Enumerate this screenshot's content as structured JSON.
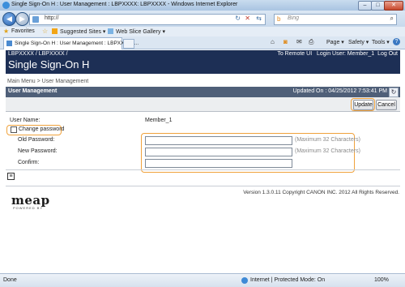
{
  "window": {
    "title": "Single Sign-On H : User Management : LBPXXXX: LBPXXXX - Windows Internet Explorer",
    "minimize": "–",
    "maximize": "□",
    "close": "✕"
  },
  "address": {
    "url": "http://",
    "search_placeholder": "Bing"
  },
  "favorites": {
    "label": "Favorites",
    "suggested": "Suggested Sites ▾",
    "gallery": "Web Slice Gallery ▾"
  },
  "tab": {
    "title": "Single Sign-On H : User Management : LBPXXXX: ..."
  },
  "command": {
    "page": "Page ▾",
    "safety": "Safety ▾",
    "tools": "Tools ▾"
  },
  "header": {
    "product": "LBPXXXX / LBPXXXX /",
    "remote_ui": "To Remote UI",
    "login_user": "Login User: Member_1",
    "logout": "Log Out",
    "app_name": "Single Sign-On H"
  },
  "breadcrumb": {
    "main": "Main Menu",
    "sep": ">",
    "current": "User Management"
  },
  "section": {
    "title": "User Management",
    "updated": "Updated On : 04/25/2012 7:53:41 PM"
  },
  "buttons": {
    "update": "Update",
    "cancel": "Cancel"
  },
  "form": {
    "user_name_label": "User Name:",
    "user_name_value": "Member_1",
    "change_password_label": "Change password",
    "old_label": "Old Password:",
    "new_label": "New Password:",
    "confirm_label": "Confirm:",
    "hint_max": "(Maximum 32 Characters)"
  },
  "footer": {
    "version": "Version 1.3.0.11 Copyright CANON INC. 2012 All Rights Reserved.",
    "logo": "meap",
    "logo_sub": "POWERED BY"
  },
  "status": {
    "done": "Done",
    "zone": "Internet | Protected Mode: On",
    "zoom": "100%"
  },
  "colors": {
    "header_bg": "#1d2f55",
    "section_bg": "#4f5f78",
    "highlight": "#f0a23c"
  }
}
